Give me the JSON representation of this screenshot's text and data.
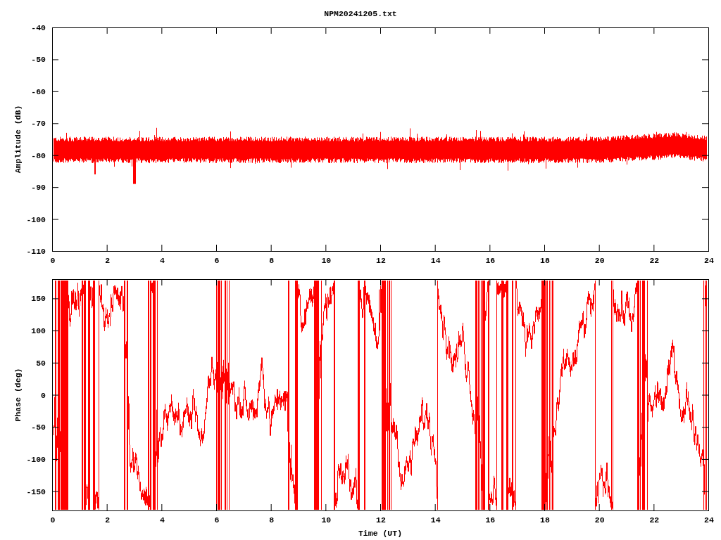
{
  "title": "NPM20241205.txt",
  "plots": [
    {
      "ylabel": "Amplitude (dB)",
      "yticks": [
        "-40",
        "-50",
        "-60",
        "-70",
        "-80",
        "-90",
        "-100",
        "-110"
      ],
      "xticks": [
        "0",
        "2",
        "4",
        "6",
        "8",
        "10",
        "12",
        "14",
        "16",
        "18",
        "20",
        "22",
        "24"
      ]
    },
    {
      "ylabel": "Phase (deg)",
      "yticks": [
        "150",
        "100",
        "50",
        "0",
        "-50",
        "-100",
        "-150"
      ],
      "xticks": [
        "0",
        "2",
        "4",
        "6",
        "8",
        "10",
        "12",
        "14",
        "16",
        "18",
        "20",
        "22",
        "24"
      ],
      "xlabel": "Time (UT)"
    }
  ]
}
